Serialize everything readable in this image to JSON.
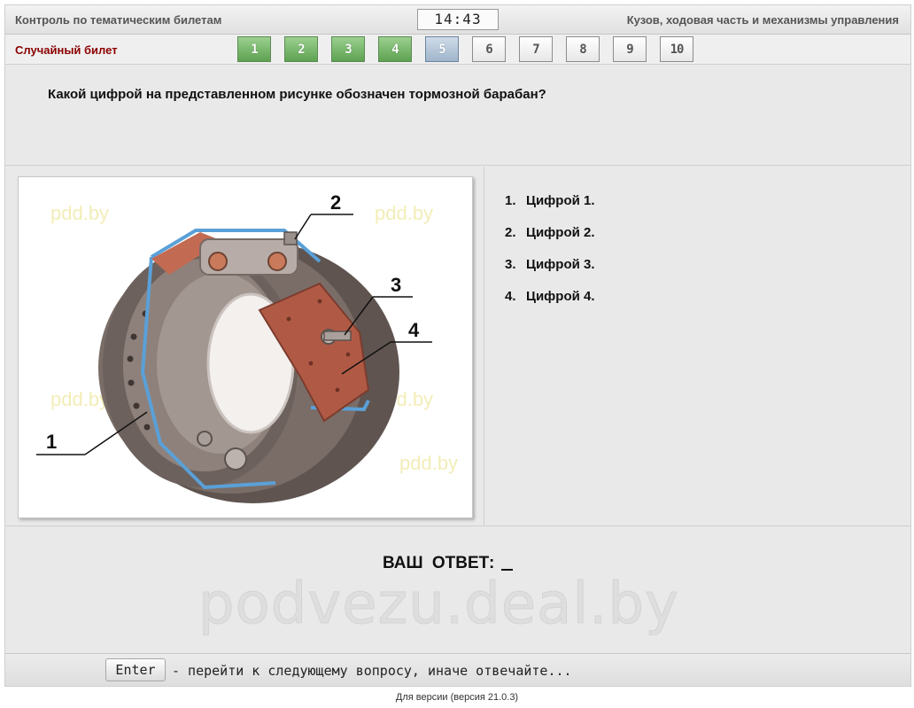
{
  "header": {
    "mode_title": "Контроль по тематическим билетам",
    "timer": "14:43",
    "section_title": "Кузов, ходовая часть и механизмы управления"
  },
  "ticket": {
    "label": "Случайный билет",
    "questions": [
      {
        "label": "1",
        "state": "done"
      },
      {
        "label": "2",
        "state": "done"
      },
      {
        "label": "3",
        "state": "done"
      },
      {
        "label": "4",
        "state": "done"
      },
      {
        "label": "5",
        "state": "current"
      },
      {
        "label": "6",
        "state": "pending"
      },
      {
        "label": "7",
        "state": "pending"
      },
      {
        "label": "8",
        "state": "pending"
      },
      {
        "label": "9",
        "state": "pending"
      },
      {
        "label": "10",
        "state": "pending"
      }
    ]
  },
  "question": {
    "text": "Какой цифрой на представленном рисунке обозначен тормозной барабан?"
  },
  "figure": {
    "callouts": [
      "1",
      "2",
      "3",
      "4"
    ],
    "watermarks": [
      "pdd.by",
      "pdd.by",
      "pdd.by",
      "pdd.by",
      "pdd.by"
    ]
  },
  "answers": [
    {
      "num": "1.",
      "text": "Цифрой 1."
    },
    {
      "num": "2.",
      "text": "Цифрой 2."
    },
    {
      "num": "3.",
      "text": "Цифрой 3."
    },
    {
      "num": "4.",
      "text": "Цифрой 4."
    }
  ],
  "response": {
    "label": "ВАШ  ОТВЕТ:",
    "watermark": "podvezu.deal.by"
  },
  "footer": {
    "key_label": "Enter",
    "hint": "- перейти к следующему вопросу, иначе отвечайте..."
  },
  "version": "Для версии (версия 21.0.3)",
  "colors": {
    "done": "#6fb063",
    "current": "#aabfd4",
    "ticket_label": "#8b0000",
    "drum": "#6e625c",
    "shoe_lining": "#b05a45",
    "backplate_edge": "#5aa0d8"
  }
}
